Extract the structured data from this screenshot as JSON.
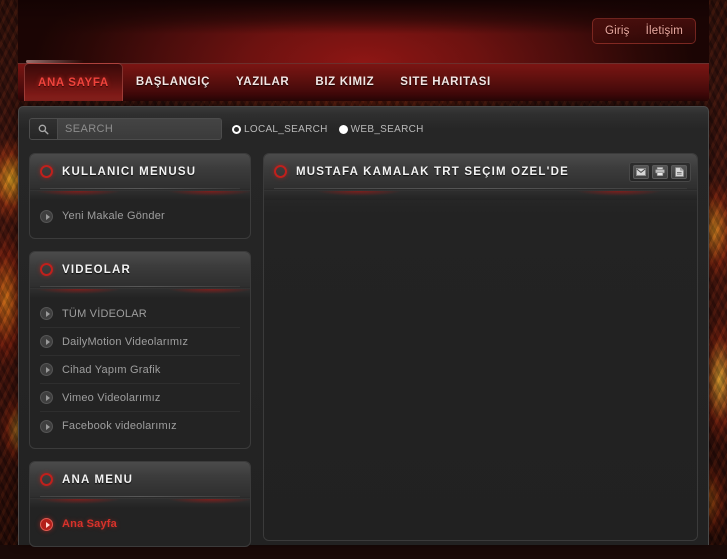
{
  "header": {
    "auth_links": [
      {
        "label": "Giriş",
        "name": "login-link"
      },
      {
        "label": "İletişim",
        "name": "contact-link"
      }
    ],
    "nav": [
      {
        "label": "ANA SAYFA",
        "active": true
      },
      {
        "label": "BAŞLANGIÇ",
        "active": false
      },
      {
        "label": "YAZILAR",
        "active": false
      },
      {
        "label": "BIZ KIMIZ",
        "active": false
      },
      {
        "label": "SITE HARITASI",
        "active": false
      }
    ]
  },
  "search": {
    "placeholder": "SEARCH",
    "value": "",
    "icon": "search-icon",
    "options": [
      {
        "label": "LOCAL_SEARCH",
        "selected": false
      },
      {
        "label": "WEB_SEARCH",
        "selected": true
      }
    ]
  },
  "sidebar": {
    "modules": [
      {
        "title": "KULLANICI MENÜSÜ",
        "name": "module-user-menu",
        "items": [
          {
            "label": "Yeni Makale Gönder",
            "active": false
          }
        ]
      },
      {
        "title": "VIDEOLAR",
        "name": "module-videos",
        "items": [
          {
            "label": "TÜM VİDEOLAR",
            "active": false
          },
          {
            "label": "DailyMotion Videolarımız",
            "active": false
          },
          {
            "label": "Cihad Yapım Grafik",
            "active": false
          },
          {
            "label": "Vimeo Videolarımız",
            "active": false
          },
          {
            "label": "Facebook videolarımız",
            "active": false
          }
        ]
      },
      {
        "title": "ANA MENÜ",
        "name": "module-main-menu",
        "items": [
          {
            "label": "Ana Sayfa",
            "active": true
          }
        ]
      }
    ]
  },
  "content": {
    "article_title": "MUSTAFA KAMALAK TRT SEÇIM ÖZEL'DE",
    "actions": [
      {
        "name": "email-icon",
        "title": "E-posta"
      },
      {
        "name": "print-icon",
        "title": "Yazdır"
      },
      {
        "name": "pdf-icon",
        "title": "PDF"
      }
    ]
  },
  "colors": {
    "accent_red": "#c0201c",
    "header_red": "#8e1614",
    "active_nav_text": "#f0433c",
    "shell_bg": "#222222",
    "module_bg": "#232323"
  }
}
